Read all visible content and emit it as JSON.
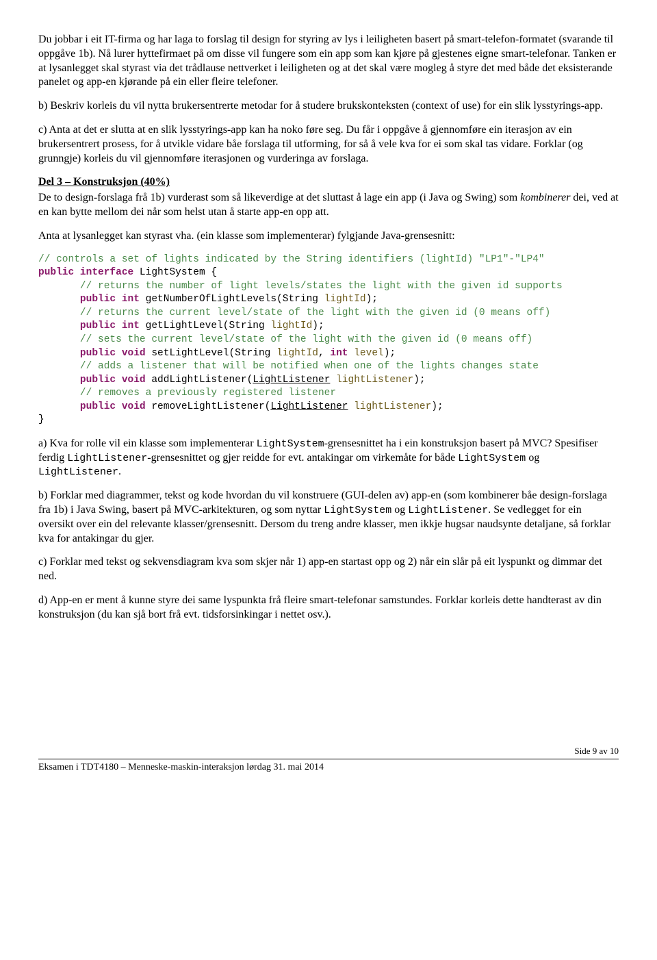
{
  "paragraphs": {
    "p1": "Du jobbar i eit IT-firma og har laga to forslag til design for styring av lys i leiligheten basert på smart-telefon-formatet (svarande til oppgåve 1b). Nå lurer hyttefirmaet på om disse vil fungere som ein app som kan kjøre på gjestenes eigne smart-telefonar. Tanken er at lysanlegget skal styrast via det trådlause nettverket i leiligheten og at det skal være mogleg å styre det med både det eksisterande panelet og app-en kjørande på ein eller fleire telefoner.",
    "p2": "b) Beskriv korleis du vil nytta brukersentrerte metodar for å studere brukskonteksten (context of use) for ein slik lysstyrings-app.",
    "p3": "c) Anta at det er slutta at en slik lysstyrings-app kan ha noko føre seg. Du får i oppgåve å gjennomføre ein iterasjon av ein brukersentrert prosess, for å utvikle vidare båe forslaga til utforming, for så å vele kva for ei som skal tas vidare. Forklar (og grunngje) korleis du vil gjennomføre iterasjonen og vurderinga av forslaga.",
    "del3_title": "Del 3 – Konstruksjon (40%)",
    "del3_a": "De to design-forslaga frå 1b) vurderast som så likeverdige at det sluttast å lage ein app (i Java og Swing) som ",
    "del3_b_italic": "kombinerer",
    "del3_c": " dei, ved at en kan bytte mellom dei når som helst utan å starte app-en opp att.",
    "p5": "Anta at lysanlegget kan styrast vha. (ein klasse som implementerar) fylgjande Java-grensesnitt:",
    "code_c1": "// controls a set of lights indicated by the String identifiers (lightId) \"LP1\"-\"LP4\"",
    "code_l1_kw1": "public interface",
    "code_l1_name": " LightSystem {",
    "code_c2": "// returns the number of light levels/states the light with the given id supports",
    "code_l2_kw": "public int",
    "code_l2_fn": " getNumberOfLightLevels(String ",
    "code_l2_p": "lightId",
    "code_l2_end": ");",
    "code_c3": "// returns the current level/state of the light with the given id (0 means off)",
    "code_l3_kw": "public int",
    "code_l3_fn": " getLightLevel(String ",
    "code_l3_p": "lightId",
    "code_l3_end": ");",
    "code_c4": "// sets the current level/state of the light with the given id (0 means off)",
    "code_l4_kw": "public void",
    "code_l4_fn": " setLightLevel(String ",
    "code_l4_p1": "lightId",
    "code_l4_mid": ", ",
    "code_l4_kw2": "int",
    "code_l4_sp": " ",
    "code_l4_p2": "level",
    "code_l4_end": ");",
    "code_c5": "// adds a listener that will be notified when one of the lights changes state",
    "code_l5_kw": "public void",
    "code_l5_fn": " addLightListener(",
    "code_l5_type": "LightListener",
    "code_l5_sp": " ",
    "code_l5_p": "lightListener",
    "code_l5_end": ");",
    "code_c6": "// removes a previously registered listener",
    "code_l6_kw": "public void",
    "code_l6_fn": " removeLightListener(",
    "code_l6_type": "LightListener",
    "code_l6_sp": " ",
    "code_l6_p": "lightListener",
    "code_l6_end": ");",
    "code_close": "}",
    "qa_1": "a) Kva for rolle vil ein klasse som implementerar ",
    "qa_ls": "LightSystem",
    "qa_2": "-grensesnittet ha i ein konstruksjon basert på MVC? Spesifiser ferdig ",
    "qa_ll": "LightListener",
    "qa_3": "-grensesnittet og gjer reidde for evt. antakingar om virkemåte for både ",
    "qa_4": " og ",
    "qa_5": ".",
    "qb_1": "b) Forklar med diagrammer, tekst og kode hvordan du vil konstruere (GUI-delen av) app-en (som kombinerer båe design-forslaga fra 1b) i Java Swing, basert på MVC-arkitekturen, og som nyttar ",
    "qb_2": " og ",
    "qb_3": ". Se vedlegget for ein oversikt over ein del relevante klasser/grensesnitt. Dersom du treng andre klasser, men ikkje hugsar naudsynte detaljane, så forklar kva for antakingar du gjer.",
    "qc": "c) Forklar med tekst og sekvensdiagram kva som skjer når 1) app-en startast opp og 2) når ein slår på eit lyspunkt og dimmar det ned.",
    "qd": "d) App-en er ment å kunne styre dei same lyspunkta frå fleire smart-telefonar samstundes. Forklar korleis dette handterast av din konstruksjon (du kan sjå bort frå evt. tidsforsinkingar i nettet osv.).",
    "footer_left": "Eksamen i TDT4180 – Menneske-maskin-interaksjon lørdag 31. mai 2014",
    "footer_right": "Side 9 av 10"
  }
}
